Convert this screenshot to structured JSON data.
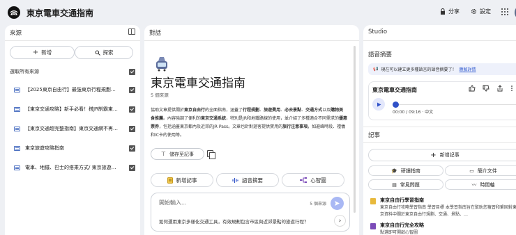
{
  "header": {
    "title": "東京電車交通指南",
    "share_label": "分享",
    "settings_label": "設定"
  },
  "sources": {
    "panel_title": "來源",
    "add_label": "新增",
    "search_label": "探索",
    "select_all_label": "選取所有來源",
    "items": [
      {
        "label": "【2025東京自由行】最強東京行程規劃懶…"
      },
      {
        "label": "【東京交通攻略】新手必看！搭JR制霸東…"
      },
      {
        "label": "【東京交通超完整指南】東京交通網不再…"
      },
      {
        "label": "東京旅遊攻略指南"
      },
      {
        "label": "電車、地鐵、巴士的搭乘方式/ 東京旅遊官…"
      }
    ]
  },
  "chat": {
    "panel_title": "對話",
    "notebook_title": "東京電車交通指南",
    "source_count": "5 個來源",
    "summary": [
      {
        "t": "協助文章提供關於",
        "b": false
      },
      {
        "t": "東京自由行",
        "b": true
      },
      {
        "t": "的全面指南，涵蓋了",
        "b": false
      },
      {
        "t": "行程規劃",
        "b": true
      },
      {
        "t": "、",
        "b": false
      },
      {
        "t": "旅遊費用",
        "b": true
      },
      {
        "t": "、",
        "b": false
      },
      {
        "t": "必去景點",
        "b": true
      },
      {
        "t": "、",
        "b": false
      },
      {
        "t": "交通方式",
        "b": true
      },
      {
        "t": "以及",
        "b": false
      },
      {
        "t": "購物美食推薦",
        "b": true
      },
      {
        "t": "。內容強調了便利的",
        "b": false
      },
      {
        "t": "東京交通系統",
        "b": true
      },
      {
        "t": "，特別是JR和地鐵路線的使用，並介紹了多種適合不同需求的",
        "b": false
      },
      {
        "t": "優惠票券",
        "b": true
      },
      {
        "t": "，包括涵蓋東京都內及近郊的JR Pass。文章也針對遊客提供實用的",
        "b": false
      },
      {
        "t": "旅行注意事項",
        "b": true
      },
      {
        "t": "，如避峰時段、禮儀和IC卡的使用等。",
        "b": false
      }
    ],
    "save_note_label": "儲存至記事",
    "actions": [
      {
        "label": "新增記事",
        "icon": "note-add-icon"
      },
      {
        "label": "語音摘要",
        "icon": "audio-wave-icon"
      },
      {
        "label": "心智圖",
        "icon": "mindmap-icon"
      }
    ],
    "input_placeholder": "開始輸入...",
    "input_source_count": "5 個來源",
    "suggestion": "如何運用東京多樣化交通工具，有效規劃包含市區與近郊景點的旅遊行程？"
  },
  "studio": {
    "panel_title": "Studio",
    "audio_section_title": "語音摘要",
    "info_text": "現在可以建立更多種語言的語音摘要了！",
    "info_link": "瞭解詳情",
    "audio_title": "東京電車交通指南",
    "audio_time": "00:00 / 09:16 · 中文",
    "audio_progress": 0,
    "notes_section_title": "記事",
    "add_note_label": "新增記事",
    "buttons": [
      {
        "label": "研讀指南",
        "icon": "study-guide-icon"
      },
      {
        "label": "簡介文件",
        "icon": "briefing-doc-icon"
      },
      {
        "label": "常見問題",
        "icon": "faq-icon"
      },
      {
        "label": "時間軸",
        "icon": "timeline-icon"
      }
    ],
    "notes": [
      {
        "title": "東京自由行學習指南",
        "desc": "東京自由行攻略學習指南 學習目標 本學習指南旨在幫助您複習和鞏固對東京資料中關於東京自由行規劃、交通、景點、…",
        "icon": "note-doc-icon",
        "color": "#e8b93c"
      },
      {
        "title": "東京自由行完全攻略",
        "desc": "點選即可開啟心智圖",
        "icon": "mindmap-icon",
        "color": "#7b4bb8"
      }
    ],
    "colors": {
      "accent": "#3052c8",
      "info_bg": "#eef1fb"
    }
  }
}
